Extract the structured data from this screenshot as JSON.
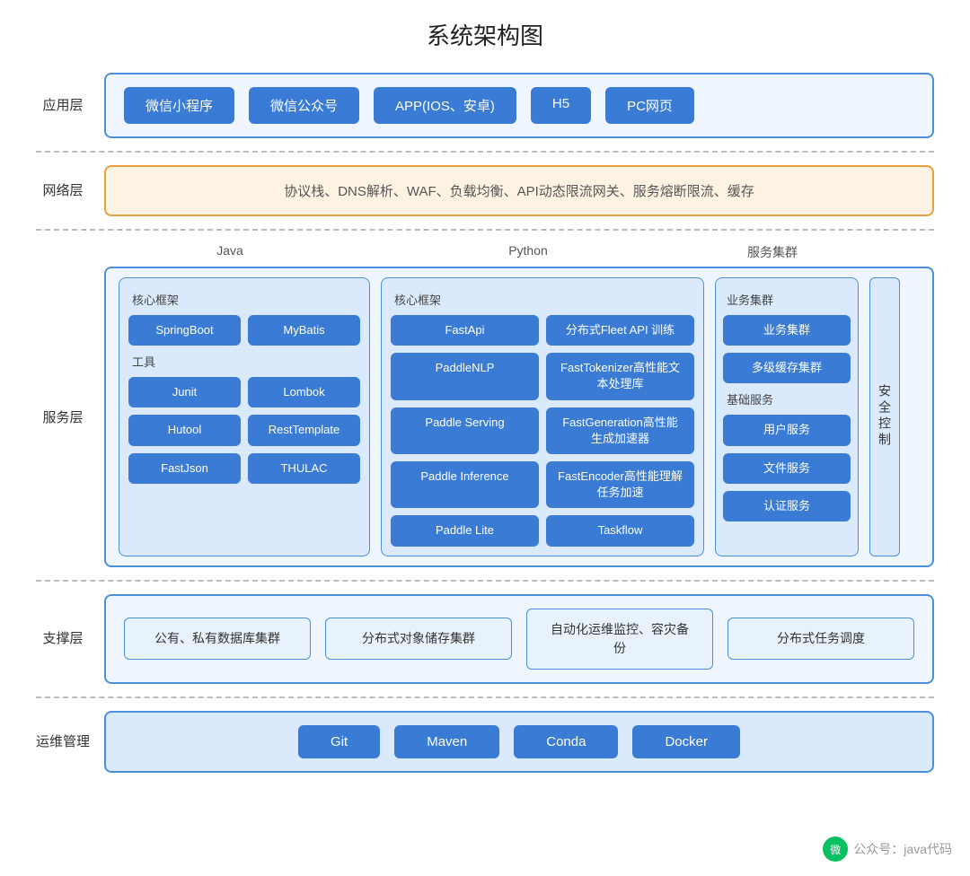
{
  "title": "系统架构图",
  "app_layer": {
    "label": "应用层",
    "items": [
      "微信小程序",
      "微信公众号",
      "APP(IOS、安卓)",
      "H5",
      "PC网页"
    ]
  },
  "network_layer": {
    "label": "网络层",
    "content": "协议栈、DNS解析、WAF、负载均衡、API动态限流网关、服务熔断限流、缓存"
  },
  "service_layer": {
    "label": "服务层",
    "java": {
      "col_title": "Java",
      "core_label": "核心框架",
      "core_items": [
        "SpringBoot",
        "MyBatis"
      ],
      "tools_label": "工具",
      "tool_items": [
        "Junit",
        "Lombok",
        "Hutool",
        "RestTemplate",
        "FastJson",
        "THULAC"
      ]
    },
    "python": {
      "col_title": "Python",
      "core_label": "核心框架",
      "items": [
        {
          "label": "FastApi",
          "span": 1
        },
        {
          "label": "分布式Fleet API 训练",
          "span": 1
        },
        {
          "label": "PaddleNLP",
          "span": 1
        },
        {
          "label": "FastTokenizer高性能文本处理库",
          "span": 1
        },
        {
          "label": "Paddle Serving",
          "span": 1
        },
        {
          "label": "FastGeneration高性能生成加速器",
          "span": 1
        },
        {
          "label": "Paddle Inference",
          "span": 1
        },
        {
          "label": "FastEncoder高性能理解任务加速",
          "span": 1
        },
        {
          "label": "Paddle Lite",
          "span": 1
        },
        {
          "label": "Taskflow",
          "span": 1
        }
      ]
    },
    "cluster": {
      "col_title": "服务集群",
      "biz_label": "业务集群",
      "biz_items": [
        "业务集群",
        "多级缓存集群"
      ],
      "base_label": "基础服务",
      "base_items": [
        "用户服务",
        "文件服务",
        "认证服务"
      ]
    },
    "security": "安全控制"
  },
  "support_layer": {
    "label": "支撑层",
    "items": [
      "公有、私有数据库集群",
      "分布式对象储存集群",
      "自动化运维监控、容灾备份",
      "分布式任务调度"
    ]
  },
  "ops_layer": {
    "label": "运维管理",
    "items": [
      "Git",
      "Maven",
      "Conda",
      "Docker"
    ]
  },
  "watermark": {
    "icon": "微",
    "text": "公众号：java代码"
  }
}
